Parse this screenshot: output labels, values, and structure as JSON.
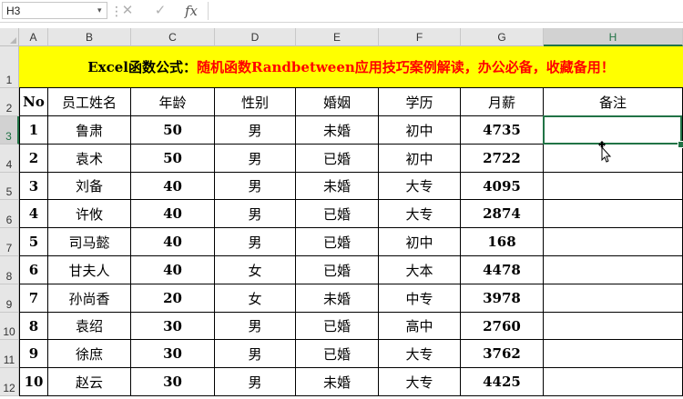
{
  "formula_bar": {
    "name_box": "H3",
    "cancel_icon": "✕",
    "enter_icon": "✓",
    "fx_label": "fx",
    "formula": ""
  },
  "columns": [
    "A",
    "B",
    "C",
    "D",
    "E",
    "F",
    "G",
    "H"
  ],
  "selected_column": "H",
  "rows": [
    "1",
    "2",
    "3",
    "4",
    "5",
    "6",
    "7",
    "8",
    "9",
    "10",
    "11",
    "12"
  ],
  "selected_row": "3",
  "banner": {
    "prefix": "Excel函数公式：",
    "suffix": "随机函数Randbetween应用技巧案例解读，办公必备，收藏备用！"
  },
  "table": {
    "headers": [
      "No",
      "员工姓名",
      "年龄",
      "性别",
      "婚姻",
      "学历",
      "月薪",
      "备注"
    ],
    "rows": [
      [
        "1",
        "鲁肃",
        "50",
        "男",
        "未婚",
        "初中",
        "4735",
        ""
      ],
      [
        "2",
        "袁术",
        "50",
        "男",
        "已婚",
        "初中",
        "2722",
        ""
      ],
      [
        "3",
        "刘备",
        "40",
        "男",
        "未婚",
        "大专",
        "4095",
        ""
      ],
      [
        "4",
        "许攸",
        "40",
        "男",
        "已婚",
        "大专",
        "2874",
        ""
      ],
      [
        "5",
        "司马懿",
        "40",
        "男",
        "已婚",
        "初中",
        "168",
        ""
      ],
      [
        "6",
        "甘夫人",
        "40",
        "女",
        "已婚",
        "大本",
        "4478",
        ""
      ],
      [
        "7",
        "孙尚香",
        "20",
        "女",
        "未婚",
        "中专",
        "3978",
        ""
      ],
      [
        "8",
        "袁绍",
        "30",
        "男",
        "已婚",
        "高中",
        "2760",
        ""
      ],
      [
        "9",
        "徐庶",
        "30",
        "男",
        "已婚",
        "大专",
        "3762",
        ""
      ],
      [
        "10",
        "赵云",
        "30",
        "男",
        "未婚",
        "大专",
        "4425",
        ""
      ]
    ]
  },
  "colors": {
    "accent": "#217346",
    "banner_bg": "#ffff00",
    "banner_red": "#ff0000"
  }
}
